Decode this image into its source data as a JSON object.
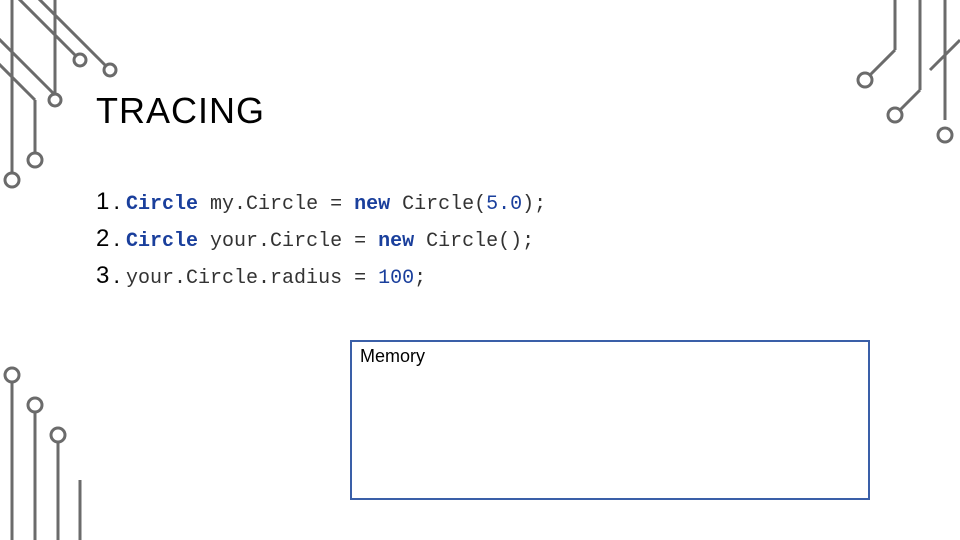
{
  "title": "TRACING",
  "code": {
    "lines": [
      {
        "n": "1",
        "type": "Circle",
        "text": " my.Circle = ",
        "kw": "new",
        "after_kw": " Circle(",
        "literal": "5.0",
        "tail": ");"
      },
      {
        "n": "2",
        "type": "Circle",
        "text": " your.Circle = ",
        "kw": "new",
        "after_kw": " Circle();",
        "literal": "",
        "tail": ""
      },
      {
        "n": "3",
        "type": "",
        "text": "your.Circle.radius = ",
        "kw": "",
        "after_kw": "",
        "literal": "100",
        "tail": ";"
      }
    ]
  },
  "memory": {
    "label": "Memory"
  }
}
